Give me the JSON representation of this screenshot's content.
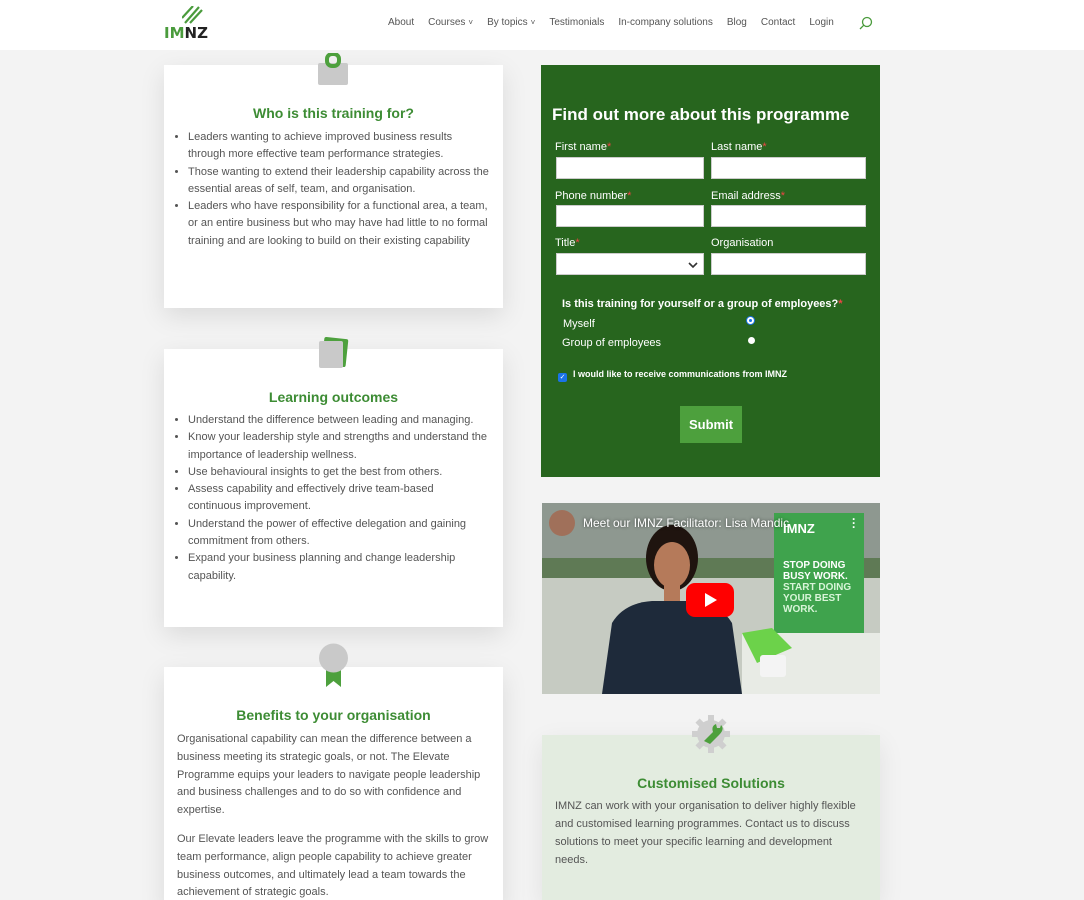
{
  "header": {
    "logo_im": "IM",
    "logo_nz": "NZ",
    "nav": [
      {
        "label": "About",
        "dropdown": false
      },
      {
        "label": "Courses",
        "dropdown": true
      },
      {
        "label": "By topics",
        "dropdown": true
      },
      {
        "label": "Testimonials",
        "dropdown": false
      },
      {
        "label": "In-company solutions",
        "dropdown": false
      },
      {
        "label": "Blog",
        "dropdown": false
      },
      {
        "label": "Contact",
        "dropdown": false
      },
      {
        "label": "Login",
        "dropdown": false
      }
    ],
    "chevron": "˅"
  },
  "who": {
    "title": "Who is this training for?",
    "items": [
      "Leaders wanting to achieve improved business results through more effective team performance strategies.",
      "Those wanting to extend their leadership capability across the essential areas of self, team, and organisation.",
      "Leaders who have responsibility for a functional area, a team, or an entire business but who may have had little to no formal training and are looking to build on their existing capability"
    ]
  },
  "outcomes": {
    "title": "Learning outcomes",
    "items": [
      "Understand the difference between leading and managing.",
      "Know your leadership style and strengths and understand the importance of leadership wellness.",
      "Use behavioural insights to get the best from others.",
      "Assess capability and effectively drive team-based continuous improvement.",
      "Understand the power of effective delegation and gaining commitment from others.",
      "Expand your business planning and change leadership capability."
    ]
  },
  "benefits": {
    "title": "Benefits to your organisation",
    "p1": "Organisational capability can mean the difference between a business meeting its strategic goals, or not. The Elevate Programme equips your leaders to navigate people leadership and business challenges and to do so with confidence and expertise.",
    "p2": "Our Elevate leaders leave the programme with the skills to grow team performance, align people capability to achieve greater business outcomes, and ultimately lead a team towards the achievement of strategic goals."
  },
  "form": {
    "title": "Find out more about this programme",
    "first_name": "First name",
    "last_name": "Last name",
    "phone": "Phone number",
    "email": "Email address",
    "title_field": "Title",
    "organisation": "Organisation",
    "required_mark": "*",
    "question": "Is this training for yourself or a group of employees?",
    "option_self": "Myself",
    "option_group": "Group of employees",
    "selected_option": "Myself",
    "checkbox_label": "I would like to receive communications from IMNZ",
    "checkbox_checked": true,
    "submit": "Submit"
  },
  "video": {
    "title": "Meet our IMNZ Facilitator: Lisa Mandic",
    "banner_brand": "IMNZ",
    "banner_line1": "STOP DOING",
    "banner_line2": "BUSY WORK.",
    "banner_line3": "START DOING",
    "banner_line4": "YOUR BEST",
    "banner_line5": "WORK."
  },
  "custom": {
    "title": "Customised Solutions",
    "body": "IMNZ can work with your organisation to deliver highly flexible and customised learning programmes. Contact us to discuss solutions to meet your specific learning and development needs."
  },
  "colors": {
    "brand_green": "#3d8c34",
    "form_bg": "#27651e",
    "submit_bg": "#4da03d"
  }
}
